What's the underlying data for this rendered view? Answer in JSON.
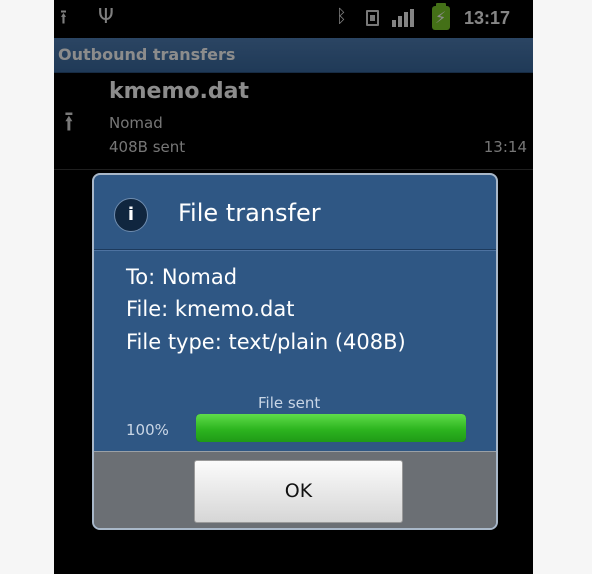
{
  "status_bar": {
    "icons": [
      "upload-icon",
      "usb-icon",
      "bluetooth-icon",
      "sim-icon",
      "signal-icon",
      "battery-charging-icon"
    ],
    "time": "13:17"
  },
  "title_bar": {
    "title": "Outbound transfers"
  },
  "transfers": [
    {
      "file": "kmemo.dat",
      "to": "Nomad",
      "status": "408B sent",
      "time": "13:14",
      "icon": "upload-icon"
    }
  ],
  "dialog": {
    "title": "File transfer",
    "icon": "info-icon",
    "to": "To: Nomad",
    "file": "File: kmemo.dat",
    "file_type": "File type: text/plain (408B)",
    "progress_label": "File sent",
    "progress_text": "100%",
    "progress": 100,
    "ok_label": "OK"
  },
  "colors": {
    "title_bar": "#4a78ad",
    "dialog_bg": "#2f5784",
    "progress_fill": "#2db51f",
    "battery": "#7dcc2a"
  }
}
